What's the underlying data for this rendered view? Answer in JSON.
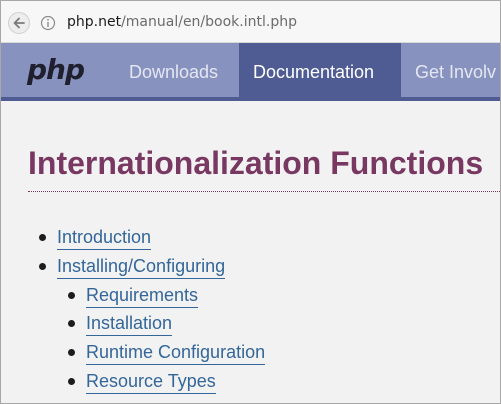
{
  "browser": {
    "url_host": "php.net",
    "url_path": "/manual/en/book.intl.php"
  },
  "nav": {
    "logo": "php",
    "items": [
      {
        "label": "Downloads",
        "active": false
      },
      {
        "label": "Documentation",
        "active": true
      },
      {
        "label": "Get Involv",
        "active": false
      }
    ]
  },
  "page": {
    "title": "Internationalization Functions",
    "toc": [
      {
        "label": "Introduction",
        "level": 1
      },
      {
        "label": "Installing/Configuring",
        "level": 1
      },
      {
        "label": "Requirements",
        "level": 2
      },
      {
        "label": "Installation",
        "level": 2
      },
      {
        "label": "Runtime Configuration",
        "level": 2
      },
      {
        "label": "Resource Types",
        "level": 2
      }
    ]
  },
  "colors": {
    "nav_bg": "#8892bf",
    "nav_active": "#4f5b93",
    "title": "#793862",
    "link": "#336699"
  }
}
